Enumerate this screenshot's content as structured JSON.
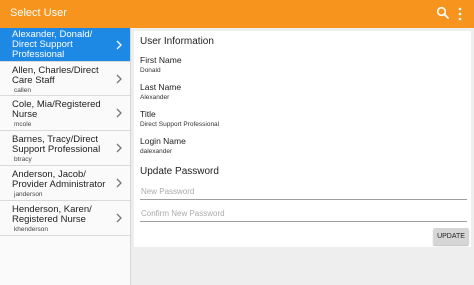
{
  "appbar": {
    "title": "Select User",
    "icons": {
      "search": "search-icon",
      "more": "more-vert-icon"
    },
    "color": "#f7941d"
  },
  "sidebar": {
    "selected_color": "#1e88e5",
    "users": [
      {
        "name": "Alexander, Donald/ Direct Support Professional",
        "login": "",
        "selected": true
      },
      {
        "name": "Allen, Charles/Direct Care Staff",
        "login": "callen"
      },
      {
        "name": "Cole, Mia/Registered Nurse",
        "login": "mcole"
      },
      {
        "name": "Barnes, Tracy/Direct Support Professional",
        "login": "btracy"
      },
      {
        "name": "Anderson, Jacob/ Provider Administrator",
        "login": "janderson"
      },
      {
        "name": "Henderson, Karen/ Registered Nurse",
        "login": "khenderson"
      }
    ]
  },
  "user_info": {
    "heading": "User Information",
    "first_name_label": "First Name",
    "first_name": "Donald",
    "last_name_label": "Last Name",
    "last_name": "Alexander",
    "title_label": "Title",
    "title": "Direct Support Professional",
    "login_label": "Login Name",
    "login": "dalexander"
  },
  "update_password": {
    "heading": "Update Password",
    "new_placeholder": "New Password",
    "confirm_placeholder": "Confirm New Password",
    "button": "UPDATE"
  }
}
